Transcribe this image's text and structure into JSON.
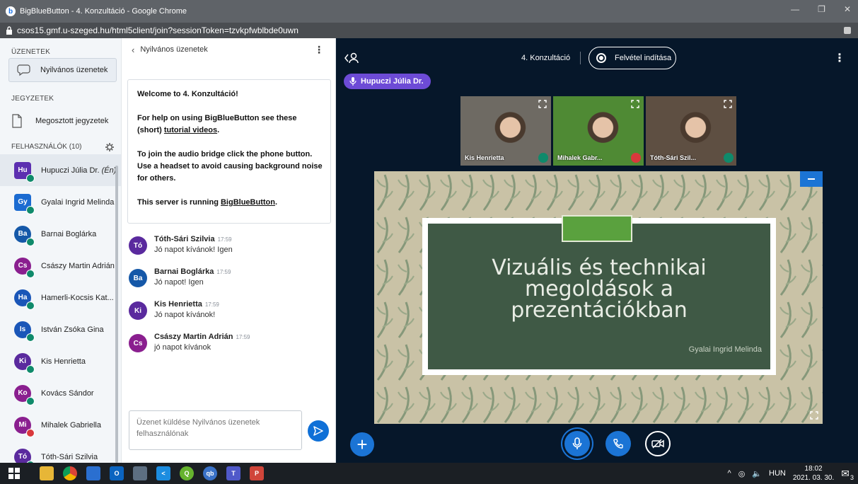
{
  "window": {
    "title": "BigBlueButton - 4. Konzultáció - Google Chrome",
    "url": "csos15.gmf.u-szeged.hu/html5client/join?sessionToken=tzvkpfwblbde0uwn"
  },
  "sidebar": {
    "messages_header": "ÜZENETEK",
    "public_chat_label": "Nyilvános üzenetek",
    "notes_header": "JEGYZETEK",
    "shared_notes_label": "Megosztott jegyzetek",
    "users_header": "FELHASZNÁLÓK (10)",
    "users": [
      {
        "initials": "Hu",
        "name": "Hupuczi Júlia Dr.",
        "suffix": "(Én)",
        "color": "#5c2fb0",
        "muted": false,
        "square": true
      },
      {
        "initials": "Gy",
        "name": "Gyalai Ingrid Melinda",
        "suffix": "",
        "color": "#1b6bd1",
        "muted": false,
        "square": true
      },
      {
        "initials": "Ba",
        "name": "Barnai Boglárka",
        "suffix": "",
        "color": "#1558a8",
        "muted": false,
        "square": false
      },
      {
        "initials": "Cs",
        "name": "Császy Martin Adrián",
        "suffix": "",
        "color": "#8a1f8f",
        "muted": false,
        "square": false
      },
      {
        "initials": "Ha",
        "name": "Hamerli-Kocsis Kat...",
        "suffix": "",
        "color": "#1a56b8",
        "muted": false,
        "square": false
      },
      {
        "initials": "Is",
        "name": "István Zsóka Gina",
        "suffix": "",
        "color": "#1a56b8",
        "muted": false,
        "square": false
      },
      {
        "initials": "Ki",
        "name": "Kis Henrietta",
        "suffix": "",
        "color": "#5a2a9e",
        "muted": false,
        "square": false
      },
      {
        "initials": "Ko",
        "name": "Kovács Sándor",
        "suffix": "",
        "color": "#8a1f8f",
        "muted": false,
        "square": false
      },
      {
        "initials": "Mi",
        "name": "Mihalek Gabriella",
        "suffix": "",
        "color": "#8a1f8f",
        "muted": true,
        "square": false
      },
      {
        "initials": "Tó",
        "name": "Tóth-Sári Szilvia",
        "suffix": "",
        "color": "#5a2a9e",
        "muted": false,
        "square": false
      }
    ]
  },
  "chat": {
    "header": "Nyilvános üzenetek",
    "welcome": {
      "line1": "Welcome to 4. Konzultáció!",
      "line2a": "For help on using BigBlueButton see these (short) ",
      "line2link": "tutorial videos",
      "line2b": ".",
      "line3": "To join the audio bridge click the phone button. Use a headset to avoid causing background noise for others.",
      "line4a": "This server is running ",
      "line4link": "BigBlueButton",
      "line4b": "."
    },
    "messages": [
      {
        "initials": "Tó",
        "name": "Tóth-Sári Szilvia",
        "time": "17:59",
        "text": "Jó napot kívánok! Igen",
        "color": "#5a2a9e"
      },
      {
        "initials": "Ba",
        "name": "Barnai Boglárka",
        "time": "17:59",
        "text": "Jó napot! Igen",
        "color": "#1558a8"
      },
      {
        "initials": "Ki",
        "name": "Kis Henrietta",
        "time": "17:59",
        "text": "Jó napot kívánok!",
        "color": "#5a2a9e"
      },
      {
        "initials": "Cs",
        "name": "Császy Martin Adrián",
        "time": "17:59",
        "text": "jó napot kívánok",
        "color": "#8a1f8f"
      }
    ],
    "input_placeholder": "Üzenet küldése Nyilvános üzenetek felhasználónak"
  },
  "main": {
    "meeting_title": "4. Konzultáció",
    "record_label": "Felvétel indítása",
    "talker": "Hupuczi Júlia Dr.",
    "cams": [
      {
        "label": "Kis Henrietta",
        "muted": false,
        "bg": "#6e6a63"
      },
      {
        "label": "Mihalek Gabr...",
        "muted": true,
        "bg": "#4f8a34"
      },
      {
        "label": "Tóth-Sári Szil...",
        "muted": false,
        "bg": "#5e4f42"
      }
    ],
    "slide": {
      "title": "Vizuális és technikai megoldások a prezentációkban",
      "author": "Gyalai Ingrid Melinda"
    }
  },
  "taskbar": {
    "lang": "HUN",
    "time": "18:02",
    "date": "2021. 03. 30.",
    "notifications": "3"
  }
}
